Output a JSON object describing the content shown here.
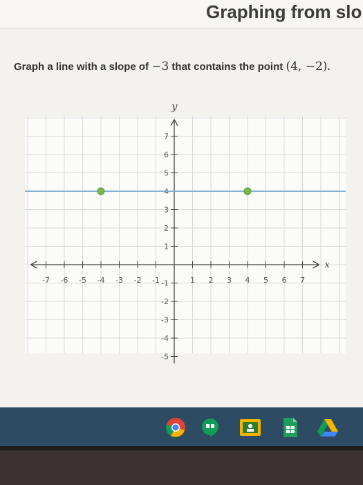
{
  "header": {
    "title": "Graphing from slop"
  },
  "prompt": {
    "text_before": "Graph a line with a slope of ",
    "slope": "−3",
    "text_middle": " that contains the point ",
    "point": "(4, −2)",
    "text_after": "."
  },
  "graph": {
    "x_axis_label": "x",
    "y_axis_label": "y",
    "x_range": [
      -7,
      7
    ],
    "y_range": [
      -5,
      7
    ],
    "line_color": "#6fa8d6",
    "point_color": "#7ab648",
    "plotted_points": [
      [
        -4,
        4
      ],
      [
        4,
        4
      ]
    ],
    "plotted_line": {
      "type": "horizontal",
      "y": 4
    }
  },
  "taskbar": {
    "apps": [
      "chrome-icon",
      "hangouts-icon",
      "classroom-icon",
      "sheets-icon",
      "drive-icon"
    ]
  }
}
